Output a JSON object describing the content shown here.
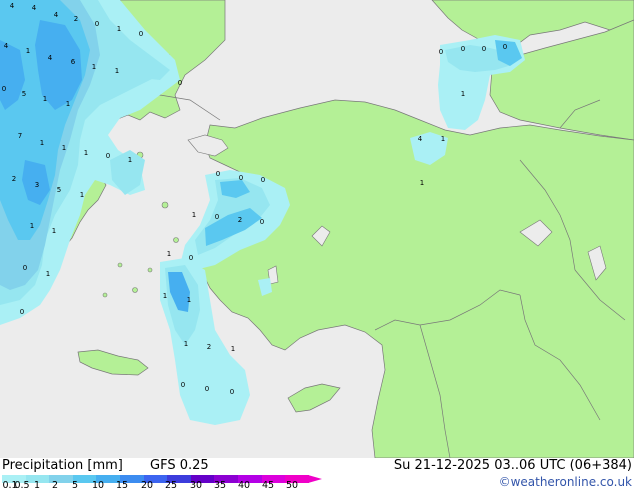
{
  "footer": {
    "title": "Precipitation [mm]",
    "model": "GFS 0.25",
    "datetime": "Su 21-12-2025 03..06 UTC (06+384)",
    "credit": "©weatheronline.co.uk"
  },
  "legend": {
    "ticks": [
      "0.1",
      "0.5",
      "1",
      "2",
      "5",
      "10",
      "15",
      "20",
      "25",
      "30",
      "35",
      "40",
      "45",
      "50"
    ],
    "colors": [
      "#aaf0f5",
      "#96e6f0",
      "#82d2eb",
      "#5ac8f0",
      "#46aff0",
      "#3c8cf0",
      "#3c64f0",
      "#3c3cdc",
      "#6400c8",
      "#8c00d2",
      "#b400e6",
      "#dc00dc",
      "#f000c8"
    ]
  },
  "map": {
    "colors": {
      "sea": "#ececec",
      "land": "#b4f096",
      "coast": "#787878",
      "border": "#787878"
    },
    "value_labels": [
      "4",
      "4",
      "4",
      "2",
      "4",
      "1",
      "4",
      "6",
      "0",
      "1",
      "0",
      "1",
      "1",
      "0",
      "0",
      "5",
      "1",
      "1",
      "7",
      "1",
      "1",
      "1",
      "0",
      "1",
      "2",
      "3",
      "5",
      "1",
      "1",
      "1",
      "0",
      "1",
      "0",
      "1",
      "0",
      "0",
      "0",
      "0",
      "1",
      "0",
      "2",
      "0",
      "1",
      "1",
      "1",
      "2",
      "1",
      "0",
      "0",
      "0",
      "0",
      "0",
      "0",
      "0",
      "1",
      "4",
      "1",
      "1",
      "0"
    ]
  }
}
